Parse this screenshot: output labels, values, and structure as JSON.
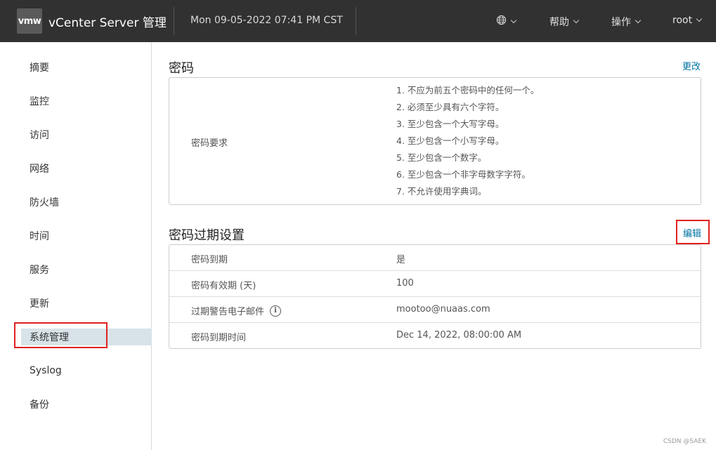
{
  "header": {
    "logo": "vmw",
    "app_title": "vCenter Server 管理",
    "datetime": "Mon 09-05-2022 07:41 PM CST",
    "menus": [
      {
        "label": ""
      },
      {
        "label": "帮助"
      },
      {
        "label": "操作"
      },
      {
        "label": "root"
      }
    ]
  },
  "sidebar": {
    "items": [
      {
        "label": "摘要"
      },
      {
        "label": "监控"
      },
      {
        "label": "访问"
      },
      {
        "label": "网络"
      },
      {
        "label": "防火墙"
      },
      {
        "label": "时间"
      },
      {
        "label": "服务"
      },
      {
        "label": "更新"
      },
      {
        "label": "系统管理",
        "active": true
      },
      {
        "label": "Syslog"
      },
      {
        "label": "备份"
      }
    ]
  },
  "password": {
    "title": "密码",
    "action": "更改",
    "req_label": "密码要求",
    "requirements": [
      "1. 不应为前五个密码中的任何一个。",
      "2. 必须至少具有六个字符。",
      "3. 至少包含一个大写字母。",
      "4. 至少包含一个小写字母。",
      "5. 至少包含一个数字。",
      "6. 至少包含一个非字母数字字符。",
      "7. 不允许使用字典词。"
    ]
  },
  "expiry": {
    "title": "密码过期设置",
    "action": "编辑",
    "rows": [
      {
        "label": "密码到期",
        "value": "是"
      },
      {
        "label": "密码有效期 (天)",
        "value": "100"
      },
      {
        "label": "过期警告电子邮件",
        "value": "mootoo@nuaas.com",
        "info": true
      },
      {
        "label": "密码到期时间",
        "value": "Dec 14, 2022, 08:00:00 AM"
      }
    ]
  },
  "watermark": "CSDN @SAEK",
  "colors": {
    "header_bg": "#313131",
    "link": "#0072a3",
    "active_nav": "#d8e3e9",
    "highlight": "#e02020"
  }
}
